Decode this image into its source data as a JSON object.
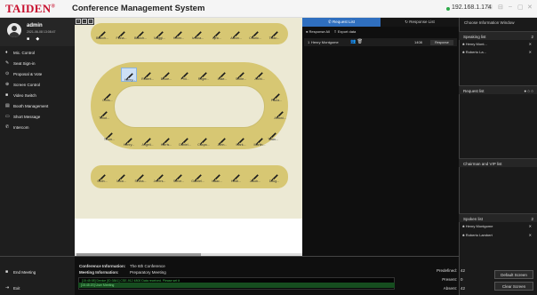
{
  "app": {
    "brand": "TAIDEN",
    "brand_mark": "®",
    "system_title": "Conference Management System",
    "ip": "192.168.1.174",
    "window_controls": [
      "⊡",
      "⊟",
      "–",
      "▢",
      "✕"
    ]
  },
  "user": {
    "name": "admin",
    "date": "2021-06-08 13:08:47"
  },
  "nav": {
    "items": [
      {
        "label": "Mic. Control",
        "icon": "mic-icon"
      },
      {
        "label": "Seat Sign-in",
        "icon": "signin-icon"
      },
      {
        "label": "Proposal & Vote",
        "icon": "vote-icon"
      },
      {
        "label": "Screen Control",
        "icon": "screen-icon"
      },
      {
        "label": "Video Switch",
        "icon": "video-icon"
      },
      {
        "label": "Booth Management",
        "icon": "booth-icon"
      },
      {
        "label": "Short Message",
        "icon": "message-icon"
      },
      {
        "label": "Intercom",
        "icon": "phone-icon"
      }
    ],
    "end_meeting": "End Meeting",
    "exit": "Exit"
  },
  "seating": {
    "top_row": [
      "Bianch...",
      "Fiona...",
      "Bianch...",
      "Maggi...",
      "Helen...",
      "Ivelina...",
      "Lyric...",
      "Aaron...",
      "Charlo...",
      "Tiffan..."
    ],
    "oval_top": [
      "Henry...",
      "Robert...",
      "Bruce...",
      "Phil...",
      "Roger...",
      "Luke...",
      "Shirle...",
      "Archi..."
    ],
    "oval_left": [
      "Chris...",
      "Timot..."
    ],
    "oval_right": [
      "Paula...",
      "Antoni..."
    ],
    "oval_bottom_corner_left": "Thom...",
    "oval_bottom_corner_right": "Tiffan...",
    "oval_bottom": [
      "Henry...",
      "Angeli...",
      "Harris...",
      "Daniel...",
      "Caspa...",
      "John...",
      "Mark...",
      "Martin..."
    ],
    "bottom_row": [
      "Colin...",
      "Mica...",
      "Selina...",
      "Jeffers...",
      "Steve...",
      "Gabriel...",
      "Isaac...",
      "Heidi...",
      "Jacob...",
      "Doug..."
    ],
    "selected_seat": "Henry..."
  },
  "requests": {
    "tab_request": "Request List",
    "tab_response": "Response List",
    "response_all": "Response All",
    "export": "Export data",
    "items": [
      {
        "index": "1",
        "name": "Henry Montgome",
        "code": "1408",
        "button": "Response"
      }
    ]
  },
  "right": {
    "choose_window": "Choose Information Window",
    "speaking_title": "Speaking list",
    "speaking_count": "2",
    "speaking": [
      "Henry Mont...",
      "Roberto La..."
    ],
    "request_title": "Request list",
    "chairman_title": "Chairman and VIP list",
    "spoken_title": "Spoken list",
    "spoken_count": "2",
    "spoken": [
      "Henry Montgome",
      "Roberto Lambert"
    ]
  },
  "info": {
    "conf_label": "Conference Information:",
    "conf_value": "The 6th Conference",
    "meeting_label": "Meeting Information:",
    "meeting_value": "Preparatory Meeting",
    "logs": [
      "[15:45:08]    Device [ID:3841] CSE-912 4800 Data received. Please set it",
      "[15:45:20]    User Meeting"
    ],
    "predefined_label": "Predefined:",
    "predefined_value": "42",
    "present_label": "Present:",
    "present_value": "0",
    "absent_label": "Absent:",
    "absent_value": "42",
    "default_screen": "Default Screen",
    "clear_screen": "Clear Screen"
  }
}
